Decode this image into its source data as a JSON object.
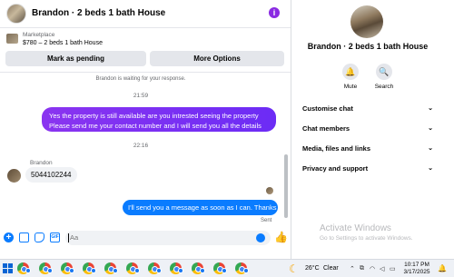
{
  "chat": {
    "title": "Brandon · 2 beds 1 bath House",
    "info_icon": "info-icon",
    "marketplace": {
      "label": "Marketplace",
      "listing": "$780 – 2 beds 1 bath House"
    },
    "buttons": {
      "pending": "Mark as pending",
      "more": "More Options"
    },
    "waiting_notice": "Brandon is waiting for your response.",
    "messages": [
      {
        "time": "21:59"
      },
      {
        "from": "me",
        "text_line1": "Yes the property is still available are you intrested seeing the property",
        "text_line2": "Please send me your contact number and I will send you all the details"
      },
      {
        "time": "22:16"
      },
      {
        "from": "Brandon",
        "sender_label": "Brandon",
        "text": "5044102244"
      },
      {
        "from": "me",
        "text": "I'll send you a message as soon as I can. Thanks",
        "status": "Sent"
      }
    ],
    "composer": {
      "placeholder": "Aa",
      "gif_label": "GIF",
      "like_icon": "thumbs-up-icon"
    }
  },
  "side": {
    "title": "Brandon · 2 beds 1 bath House",
    "actions": [
      {
        "label": "Mute",
        "icon": "bell-icon"
      },
      {
        "label": "Search",
        "icon": "search-icon"
      }
    ],
    "sections": [
      "Customise chat",
      "Chat members",
      "Media, files and links",
      "Privacy and support"
    ],
    "watermark_title": "Activate Windows",
    "watermark_sub": "Go to Settings to activate Windows."
  },
  "taskbar": {
    "temperature": "26°C",
    "condition": "Clear",
    "time": "10:17 PM",
    "date": "3/17/2025"
  },
  "colors": {
    "outgoing_bubble": "#7b2ff7",
    "outgoing_bubble_2": "#0a7cff",
    "incoming_bubble": "#f0f2f5",
    "accent": "#0a7cff"
  }
}
